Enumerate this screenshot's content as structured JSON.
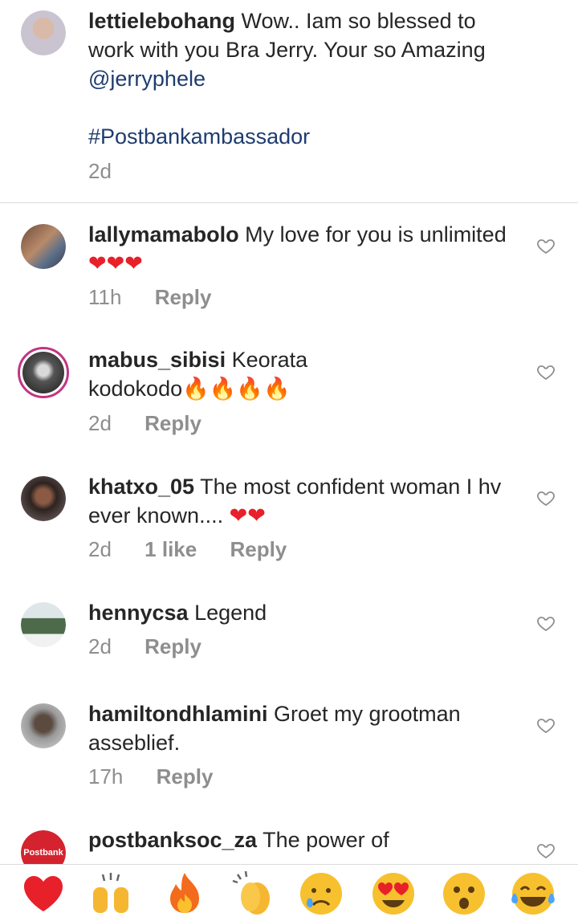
{
  "caption": {
    "username": "lettielebohang",
    "text_line1": "Wow.. Iam so blessed to",
    "text_line2": "work with you Bra Jerry. Your so Amazing",
    "mention": "@jerryphele",
    "hashtag": "#Postbankambassador",
    "time": "2d"
  },
  "comments": [
    {
      "username": "lallymamabolo",
      "text": "My love for you is unlimited",
      "emoji": "❤❤❤",
      "time": "11h",
      "likes": "",
      "reply": "Reply"
    },
    {
      "username": "mabus_sibisi",
      "text": "Keorata",
      "text2": "kodokodo",
      "emoji": "🔥🔥🔥🔥",
      "time": "2d",
      "likes": "",
      "reply": "Reply"
    },
    {
      "username": "khatxo_05",
      "text": "The most confident woman I hv",
      "text2": "ever known....",
      "emoji": "❤❤",
      "time": "2d",
      "likes": "1 like",
      "reply": "Reply"
    },
    {
      "username": "hennycsa",
      "text": "Legend",
      "time": "2d",
      "likes": "",
      "reply": "Reply"
    },
    {
      "username": "hamiltondhlamini",
      "text": "Groet my grootman",
      "text2": "asseblief.",
      "time": "17h",
      "likes": "",
      "reply": "Reply"
    },
    {
      "username": "postbanksoc_za",
      "text": "The power of",
      "avatar_text": "Postbank"
    }
  ],
  "emoji_bar": [
    "red-heart",
    "raising-hands",
    "fire",
    "clapping-hands",
    "crying-face",
    "heart-eyes-face",
    "astonished-face",
    "tears-of-joy-face"
  ],
  "colors": {
    "link": "#1e3c6f",
    "meta": "#8e8e8e",
    "heart": "#e8202a",
    "postbank": "#d4232f"
  }
}
